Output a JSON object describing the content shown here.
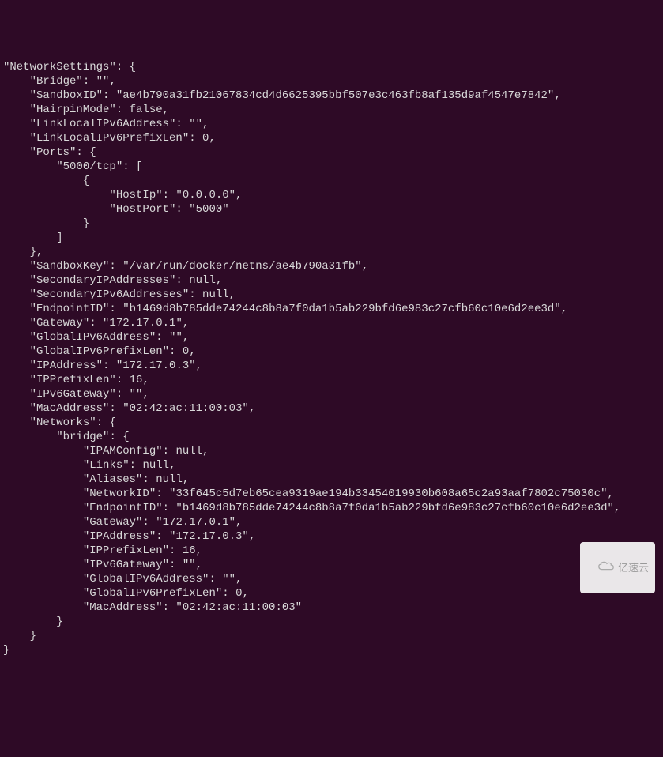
{
  "json": {
    "root_key": "NetworkSettings",
    "Bridge": "",
    "SandboxID": "ae4b790a31fb21067834cd4d6625395bbf507e3c463fb8af135d9af4547e7842",
    "HairpinMode": "false",
    "LinkLocalIPv6Address": "",
    "LinkLocalIPv6PrefixLen": "0",
    "Ports_key": "Ports",
    "port_5000": "5000/tcp",
    "HostIp": "0.0.0.0",
    "HostPort": "5000",
    "SandboxKey": "/var/run/docker/netns/ae4b790a31fb",
    "SecondaryIPAddresses": "null",
    "SecondaryIPv6Addresses": "null",
    "EndpointID": "b1469d8b785dde74244c8b8a7f0da1b5ab229bfd6e983c27cfb60c10e6d2ee3d",
    "Gateway": "172.17.0.1",
    "GlobalIPv6Address": "",
    "GlobalIPv6PrefixLen": "0",
    "IPAddress": "172.17.0.3",
    "IPPrefixLen": "16",
    "IPv6Gateway": "",
    "MacAddress": "02:42:ac:11:00:03",
    "Networks_key": "Networks",
    "bridge_key": "bridge",
    "bridge": {
      "IPAMConfig": "null",
      "Links": "null",
      "Aliases": "null",
      "NetworkID": "33f645c5d7eb65cea9319ae194b33454019930b608a65c2a93aaf7802c75030c",
      "EndpointID": "b1469d8b785dde74244c8b8a7f0da1b5ab229bfd6e983c27cfb60c10e6d2ee3d",
      "Gateway": "172.17.0.1",
      "IPAddress": "172.17.0.3",
      "IPPrefixLen": "16",
      "IPv6Gateway": "",
      "GlobalIPv6Address": "",
      "GlobalIPv6PrefixLen": "0",
      "MacAddress": "02:42:ac:11:00:03"
    }
  },
  "watermark": "亿速云"
}
